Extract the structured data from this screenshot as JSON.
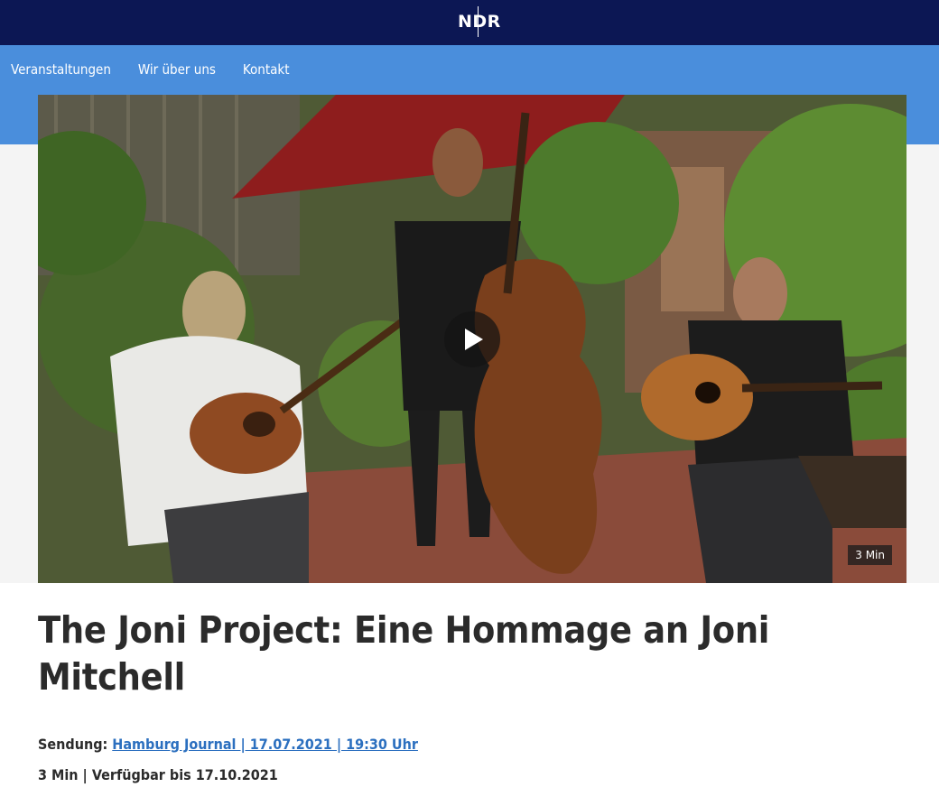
{
  "header": {
    "logo_text": "NDR",
    "colors": {
      "topbar": "#0c1754",
      "navbar": "#4a8edc",
      "link": "#2b6fbf"
    }
  },
  "nav": {
    "items": [
      {
        "label": "Veranstaltungen"
      },
      {
        "label": "Wir über uns"
      },
      {
        "label": "Kontakt"
      }
    ]
  },
  "video": {
    "play_icon": "play-icon",
    "duration": "3 Min"
  },
  "article": {
    "title": "The Joni Project: Eine Hommage an Joni Mitchell",
    "sendung_label": "Sendung:",
    "sendung_link": "Hamburg Journal | 17.07.2021 | 19:30 Uhr",
    "meta_duration": "3 Min",
    "meta_separator": "|",
    "meta_available": "Verfügbar bis 17.10.2021"
  }
}
